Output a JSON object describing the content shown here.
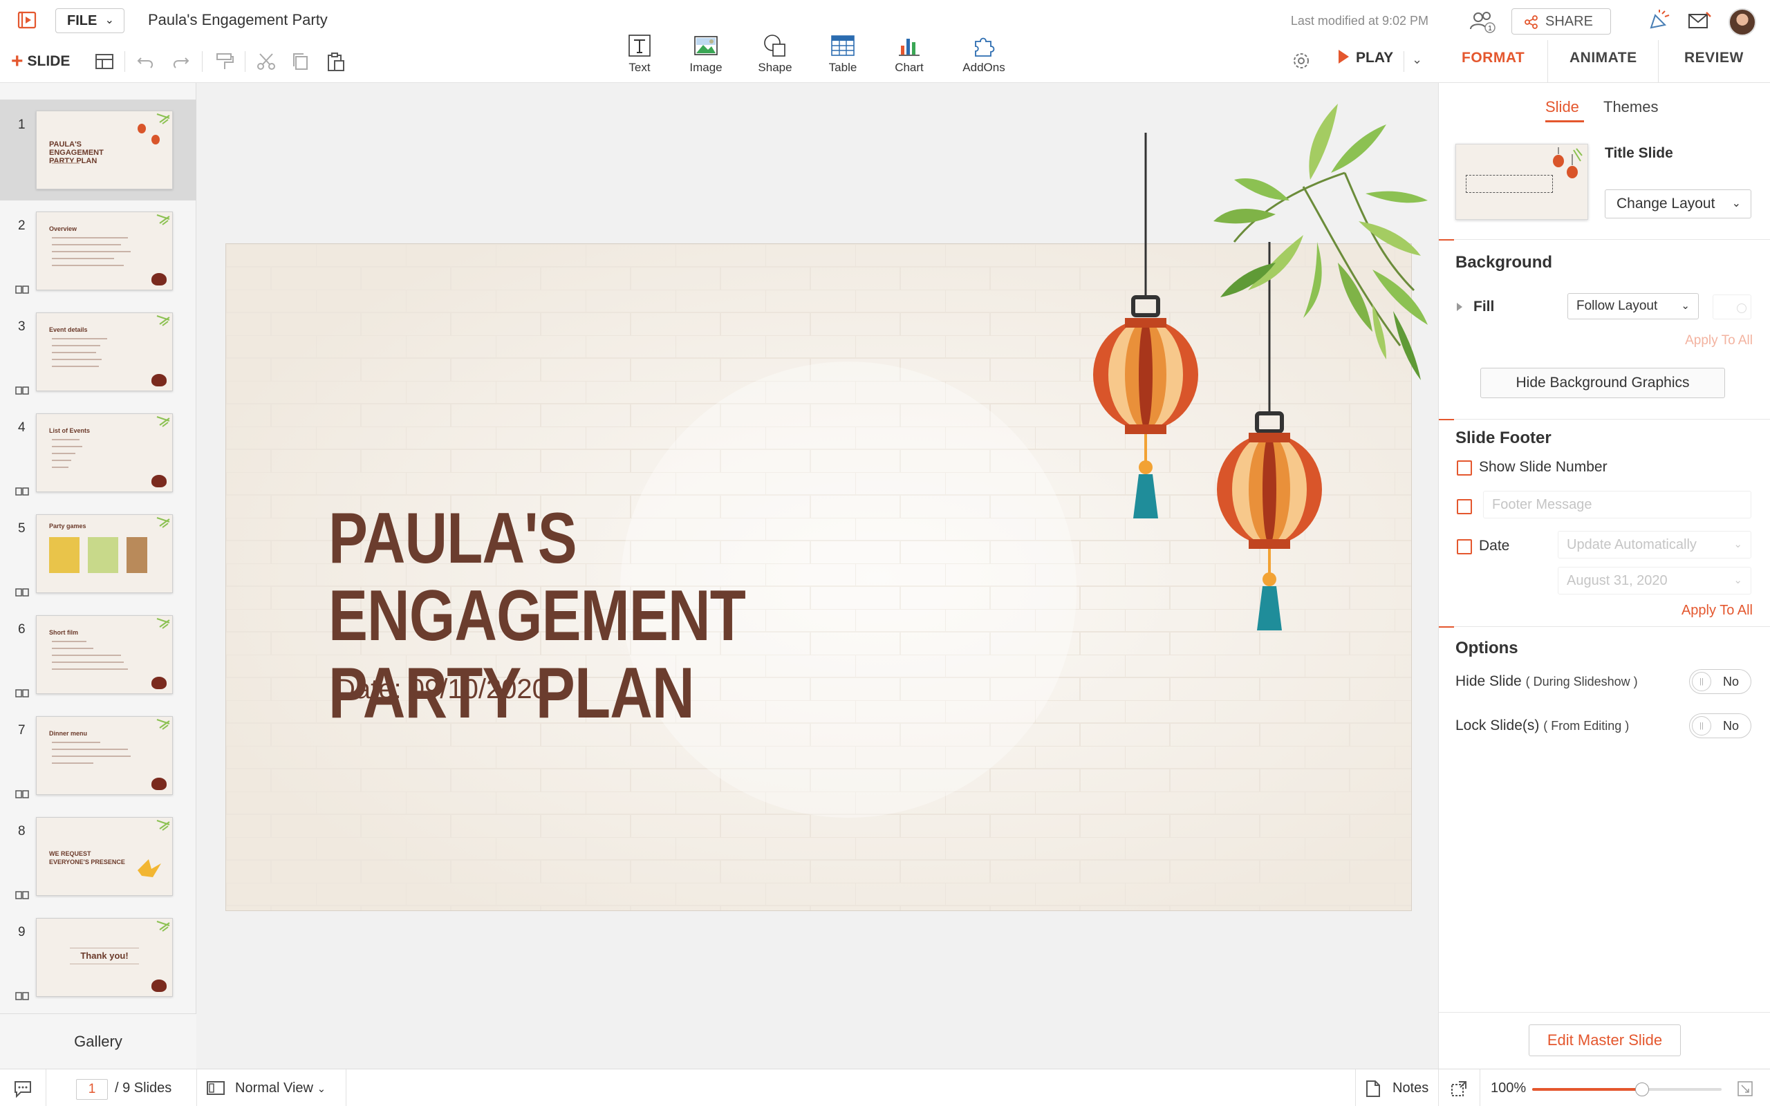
{
  "app": {
    "file_label": "FILE",
    "doc_title": "Paula's Engagement Party",
    "last_modified": "Last modified at 9:02 PM",
    "share_label": "SHARE",
    "collab_count": "1"
  },
  "toolbar": {
    "add_slide_label": "SLIDE",
    "play_label": "PLAY",
    "insert_tools": [
      {
        "label": "Text",
        "icon": "text-icon"
      },
      {
        "label": "Image",
        "icon": "image-icon"
      },
      {
        "label": "Shape",
        "icon": "shape-icon"
      },
      {
        "label": "Table",
        "icon": "table-icon"
      },
      {
        "label": "Chart",
        "icon": "chart-icon"
      },
      {
        "label": "AddOns",
        "icon": "puzzle-icon"
      }
    ]
  },
  "right_tabs": [
    "FORMAT",
    "ANIMATE",
    "REVIEW"
  ],
  "thumbnails": [
    {
      "num": "1",
      "title": "PAULA'S ENGAGEMENT PARTY PLAN"
    },
    {
      "num": "2",
      "title": "Overview"
    },
    {
      "num": "3",
      "title": "Event details"
    },
    {
      "num": "4",
      "title": "List of Events"
    },
    {
      "num": "5",
      "title": "Party games"
    },
    {
      "num": "6",
      "title": "Short film"
    },
    {
      "num": "7",
      "title": "Dinner menu"
    },
    {
      "num": "8",
      "title": "WE REQUEST EVERYONE'S PRESENCE"
    },
    {
      "num": "9",
      "title": "Thank you!"
    }
  ],
  "gallery_label": "Gallery",
  "slide": {
    "title_line1": "PAULA'S ENGAGEMENT",
    "title_line2": "PARTY PLAN",
    "date": "Date: 09/10/2020"
  },
  "format_panel": {
    "subtabs": [
      "Slide",
      "Themes"
    ],
    "layout_name": "Title Slide",
    "change_layout": "Change Layout",
    "background_title": "Background",
    "fill_label": "Fill",
    "fill_value": "Follow Layout",
    "apply_all_disabled": "Apply To All",
    "hide_bg_graphics": "Hide Background Graphics",
    "footer_title": "Slide Footer",
    "show_slide_number": "Show Slide Number",
    "footer_message_placeholder": "Footer Message",
    "date_label": "Date",
    "update_auto": "Update Automatically",
    "date_value": "August 31, 2020",
    "apply_all": "Apply To All",
    "options_title": "Options",
    "hide_slide": "Hide Slide",
    "hide_slide_note": "( During Slideshow )",
    "lock_slide": "Lock Slide(s)",
    "lock_slide_note": "( From Editing )",
    "toggle_value": "No",
    "edit_master": "Edit Master Slide"
  },
  "status": {
    "page": "1",
    "total": "/ 9 Slides",
    "view": "Normal View",
    "notes": "Notes",
    "zoom": "100%",
    "zoom_level": 0.58
  },
  "colors": {
    "accent": "#e4572e",
    "title_brown": "#6b3d2e"
  }
}
